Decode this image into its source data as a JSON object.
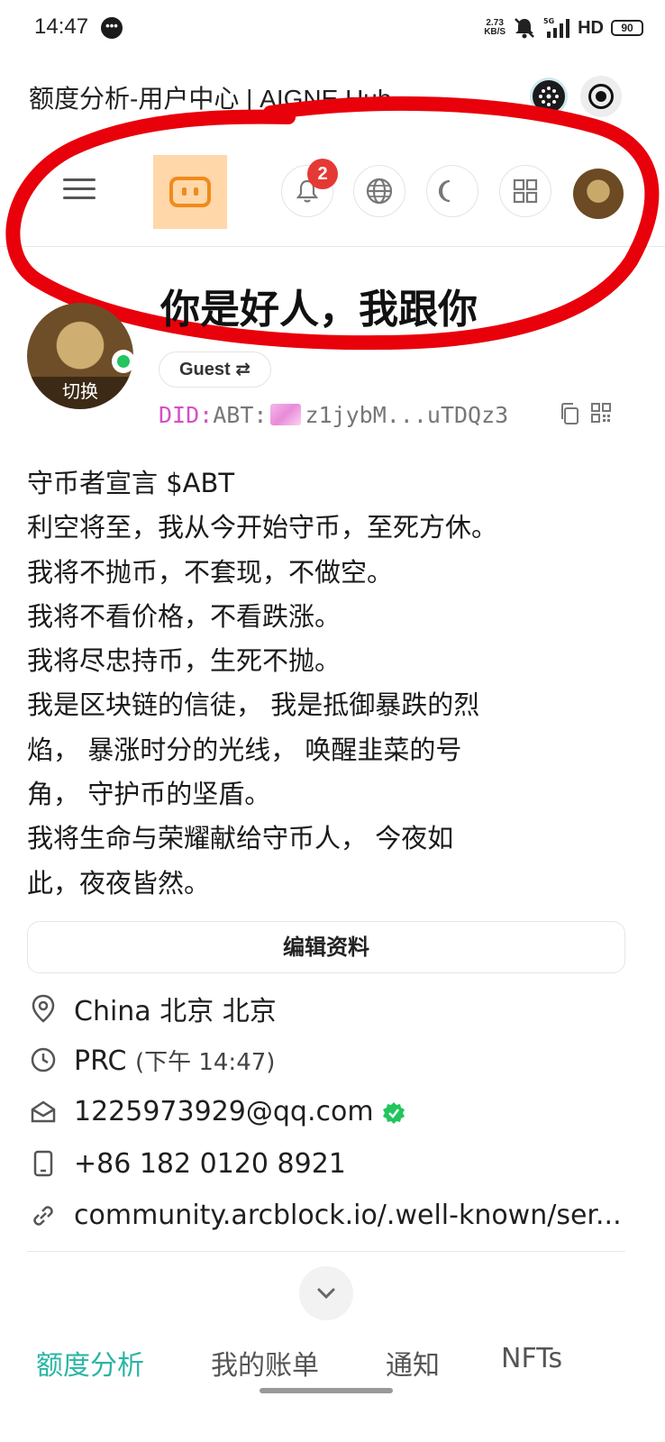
{
  "status_bar": {
    "time": "14:47",
    "net_speed_value": "2.73",
    "net_speed_unit": "KB/S",
    "network": "5G",
    "hd": "HD",
    "battery": "90"
  },
  "title_bar": {
    "title": "额度分析-用户中心 | AIGNE Hub"
  },
  "header": {
    "notification_count": "2",
    "icons": [
      "menu-icon",
      "app-logo",
      "bell-icon",
      "globe-icon",
      "moon-icon",
      "apps-grid-icon",
      "avatar"
    ]
  },
  "profile": {
    "slogan": "你是好人，我跟你",
    "avatar_action": "切换",
    "role": "Guest ⇄",
    "did_prefix": "DID:",
    "did_value": "ABT:",
    "did_short": "z1jybM...uTDQz3",
    "bio": "守币者宣言 $ABT\n利空将至，我从今开始守币，至死方休。\n我将不抛币，不套现，不做空。\n我将不看价格，不看跌涨。\n我将尽忠持币，生死不抛。\n我是区块链的信徒， 我是抵御暴跌的烈\n焰， 暴涨时分的光线， 唤醒韭菜的号\n角， 守护币的坚盾。\n我将生命与荣耀献给守币人， 今夜如\n此，夜夜皆然。",
    "edit_button": "编辑资料",
    "location": "China 北京 北京",
    "timezone": "PRC",
    "local_time": "(下午 14:47)",
    "email": "1225973929@qq.com",
    "phone": "+86 182 0120 8921",
    "link": "community.arcblock.io/.well-known/ser..."
  },
  "tabs": [
    {
      "label": "额度分析",
      "active": true
    },
    {
      "label": "我的账单",
      "active": false
    },
    {
      "label": "通知",
      "active": false
    },
    {
      "label": "NFTs",
      "active": false
    }
  ],
  "colors": {
    "accent": "#2bb5a5",
    "logo_bg": "#ffd7a8",
    "logo_fg": "#f08a1c",
    "badge": "#e53935",
    "online": "#22c55e",
    "did_prefix": "#d450c4",
    "annotation": "#e8000b"
  }
}
